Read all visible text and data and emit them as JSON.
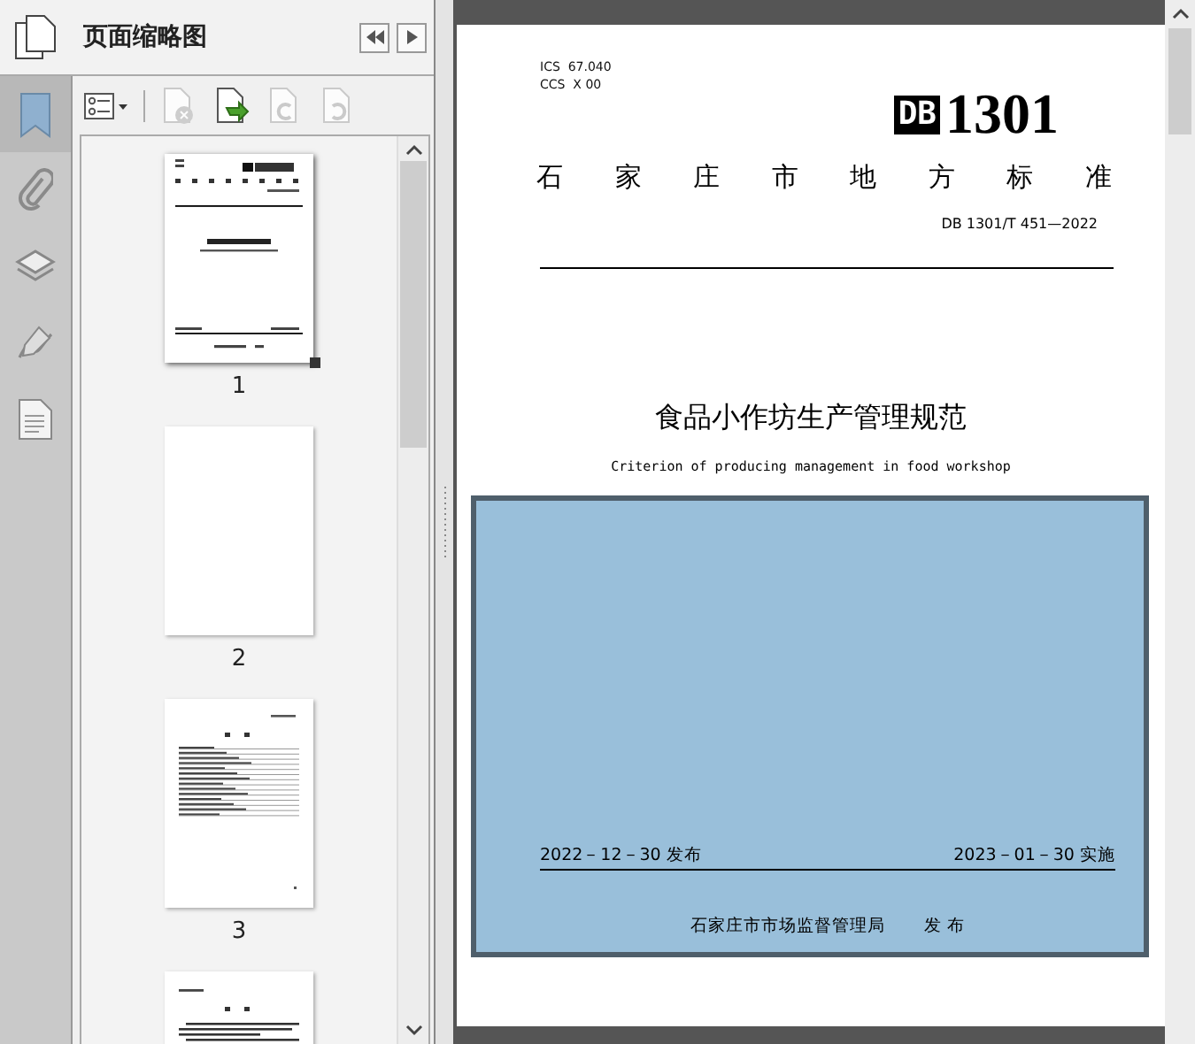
{
  "panel": {
    "title": "页面缩略图"
  },
  "toolbar": [
    {
      "kind": "options",
      "disabled": false
    },
    {
      "kind": "delete",
      "disabled": true
    },
    {
      "kind": "insert",
      "disabled": false
    },
    {
      "kind": "rotate-left",
      "disabled": true
    },
    {
      "kind": "rotate-right",
      "disabled": true
    }
  ],
  "thumbnails": [
    {
      "kind": "cover",
      "label": "1",
      "selected": true
    },
    {
      "kind": "blank",
      "label": "2",
      "selected": false
    },
    {
      "kind": "contents",
      "label": "3",
      "selected": false
    },
    {
      "kind": "foreword",
      "selected": false
    }
  ],
  "document": {
    "ics": "ICS  67.040",
    "ccs": "CCS  X 00",
    "logo_letters": "DB",
    "logo_number": "1301",
    "series": "石 家 庄 市 地 方 标 准",
    "code": "DB 1301/T 451—2022",
    "title": "食品小作坊生产管理规范",
    "subtitle": "Criterion of producing management in food workshop",
    "issue_date": "2022－12－30 发布",
    "effective_date": "2023－01－30 实施",
    "issuer": "石家庄市市场监督管理局",
    "issuer_action": "发 布"
  }
}
